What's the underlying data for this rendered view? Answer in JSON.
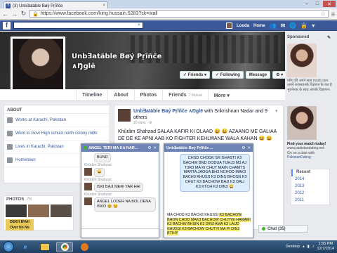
{
  "browser": {
    "tab_title": "(3) Unb∃atäble Bøý Pŗĩñĉe",
    "tab_close": "×",
    "url": "https://www.facebook.com/king.hussain.5283?sk=wall",
    "window_controls": [
      "–",
      "□",
      "✕"
    ]
  },
  "fb_header": {
    "logo": "f",
    "user_name": "Looda",
    "home_label": "Home"
  },
  "profile": {
    "name": "Unb∃atäble Bøý Pŗĩñĉe ∧Ŋglë",
    "buttons": {
      "friends": "✓ Friends ▾",
      "following": "✓ Following",
      "message": "Message",
      "more": "⚙ ▾"
    },
    "nav": {
      "timeline": "Timeline",
      "about": "About",
      "photos": "Photos",
      "friends": "Friends",
      "friends_sub": "7 Mutual",
      "more": "More ▾"
    }
  },
  "about": {
    "heading": "ABOUT",
    "items": [
      "Works at Karachi, Pakistan",
      "Went to Govt High school north colony mithi",
      "Lives in Karachi, Pakistan",
      "Hometown"
    ]
  },
  "photos": {
    "heading": "PHOTOS",
    "count": "7K",
    "caption_line1": "DEKH BHAI",
    "caption_line2": "Over No No"
  },
  "post": {
    "author": "Unb∃atäble Bøý Pŗĩñĉe ∧Ŋglë",
    "with_text": "with Srikrishnan Nadar and 9 others",
    "meta": "20 mins · ⚙",
    "body": "Khûrâm Shahzad SALAA KAFIR KI OLAAD 😀 😀 AZAANO ME GALIAA DE DE KE APNI AAB KO FIGHTER KEHLWANE WALA KAHAN 😀 😀 APNI"
  },
  "chat1": {
    "title": "ANGEL TERI MA KA NAR...",
    "controls": [
      "⚙",
      "✕"
    ],
    "messages": [
      {
        "sender": "",
        "text": "BUND"
      },
      {
        "sender": "Khûrâm Shahzad",
        "text": "😀"
      },
      {
        "sender": "Khûrâm Shahzad",
        "text": "ISKI BAJI MERI YAR HAI"
      },
      {
        "sender": "Khûrâm Shahzad",
        "text": "ANGEL LODER NA BOL DENA ISKO 😀 😀"
      }
    ]
  },
  "chat2": {
    "title": "Unb∃atäble Bøý Pŗĩñĉe ...",
    "controls": [
      "⚙",
      "✕"
    ],
    "sent": "CHSD CHODK SR GHASTI K3 BACHW BND DODUA TUHJ3 M3 AJ T3R3 MA KI CHUT MAIN CHAMTS MARTA JAOGA BH3 NCHOD MAK3 BACH3 KHUSS K3 DINS BHOSN K3 CHUT K3 BACHOW BAJI K3 DALI K3 KTCH K3 DIN3 😀",
    "typed_plain": "MA CHOD K3 BACH2 KHUSSI ",
    "typed_hl": "K3 BACHOW BHON CHOD MAK3 BACHOW CHUTYE HARAMI K3 BACHW BHSIN K3 DIN3 AMA K3 LAUD KHUSSI K3 BACHOW CHUTYI MA PI DIN3 BTIHY"
  },
  "sponsored": {
    "heading": "Sponsored",
    "ad1_text": "परिए की अपने सत्य modi.com अपने राजस्थानके विज्ञापन के चल है भुवनेश्वर के साथ आपके विज्ञापन।",
    "ad2_title": "Find your match today!",
    "ad2_url": "www.pakistandating.net",
    "ad2_desc": "Go on a date with",
    "ad2_name": "PakistanDating"
  },
  "years": {
    "items": [
      "Recent",
      "2014",
      "2013",
      "2012",
      "2011"
    ]
  },
  "chatbar": {
    "label": "Chat (35)"
  },
  "taskbar": {
    "apps": [
      "ie-icon",
      "folder-icon",
      "chrome-icon",
      "media-icon"
    ],
    "desktop_label": "Desktop",
    "time": "1:55 PM",
    "date": "12/7/2014"
  }
}
